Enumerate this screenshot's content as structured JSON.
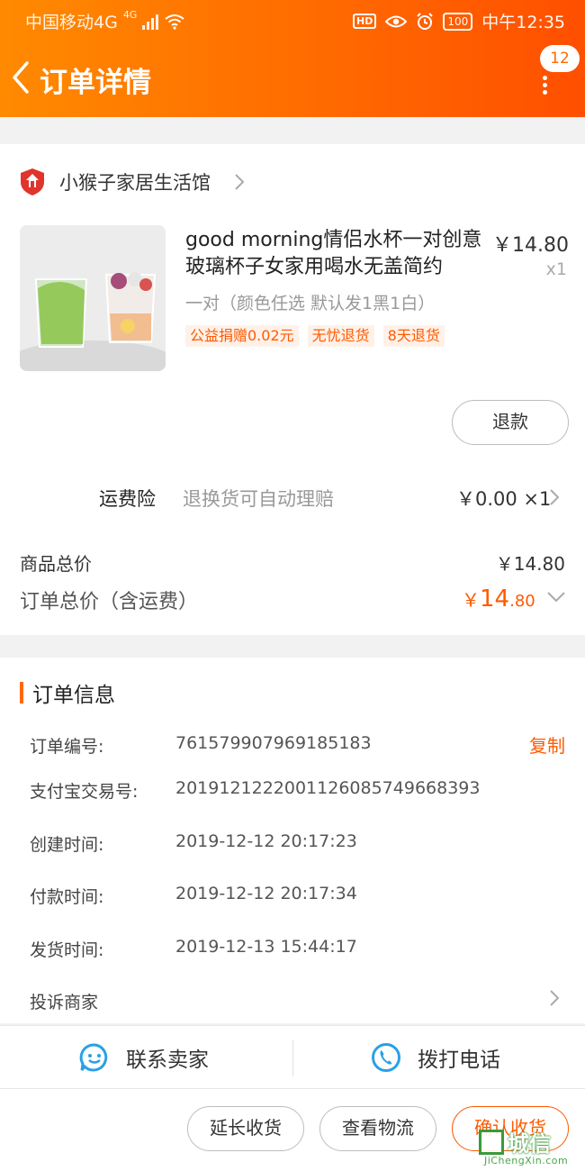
{
  "status_bar": {
    "carrier": "中国移动4G",
    "net_tag": "4G",
    "hd": "HD",
    "battery": "100",
    "time": "中午12:35"
  },
  "nav": {
    "title": "订单详情",
    "message_count": "12"
  },
  "shop": {
    "name": "小猴子家居生活馆"
  },
  "product": {
    "title": "good morning情侣水杯一对创意玻璃杯子女家用喝水无盖简约",
    "price": "￥14.80",
    "quantity": "x1",
    "spec": "一对（颜色任选 默认发1黑1白）",
    "tags": [
      "公益捐赠0.02元",
      "无忧退货",
      "8天退货"
    ],
    "refund_label": "退款"
  },
  "shipping_insurance": {
    "label": "运费险",
    "description": "退换货可自动理赔",
    "price": "￥0.00 ×1"
  },
  "totals": {
    "goods_total_label": "商品总价",
    "goods_total_value": "￥14.80",
    "order_total_label": "订单总价（含运费）",
    "order_total_symbol": "￥",
    "order_total_int": "14",
    "order_total_dec": ".80"
  },
  "order_info": {
    "title": "订单信息",
    "rows": [
      {
        "label": "订单编号:",
        "value": "761579907969185183"
      },
      {
        "label": "支付宝交易号:",
        "value": "2019121222001126085749668393"
      },
      {
        "label": "创建时间:",
        "value": "2019-12-12 20:17:23"
      },
      {
        "label": "付款时间:",
        "value": "2019-12-12 20:17:34"
      },
      {
        "label": "发货时间:",
        "value": "2019-12-13 15:44:17"
      }
    ],
    "copy_label": "复制",
    "complain_label": "投诉商家"
  },
  "contact": {
    "seller_label": "联系卖家",
    "call_label": "拨打电话"
  },
  "actions": {
    "extend_label": "延长收货",
    "logistics_label": "查看物流",
    "confirm_label": "确认收货"
  },
  "watermark": {
    "main": "城信",
    "sub": "JiChengXin.com"
  },
  "colors": {
    "brand_orange": "#ff6a00",
    "price_orange": "#ff5a00",
    "watermark_green": "#3a9a3a"
  }
}
